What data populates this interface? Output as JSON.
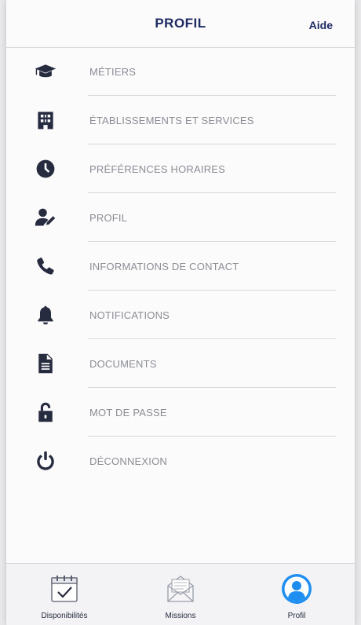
{
  "header": {
    "title": "PROFIL",
    "help_label": "Aide"
  },
  "menu": [
    {
      "label": "MÉTIERS",
      "icon": "graduation-cap-icon"
    },
    {
      "label": "ÉTABLISSEMENTS ET SERVICES",
      "icon": "building-icon"
    },
    {
      "label": "PRÉFÉRENCES HORAIRES",
      "icon": "clock-icon"
    },
    {
      "label": "PROFIL",
      "icon": "user-edit-icon"
    },
    {
      "label": "INFORMATIONS DE CONTACT",
      "icon": "phone-icon"
    },
    {
      "label": "NOTIFICATIONS",
      "icon": "bell-icon"
    },
    {
      "label": "DOCUMENTS",
      "icon": "document-icon"
    },
    {
      "label": "MOT DE PASSE",
      "icon": "unlock-icon"
    },
    {
      "label": "DÉCONNEXION",
      "icon": "power-icon"
    }
  ],
  "tabs": [
    {
      "label": "Disponibilités",
      "icon": "calendar-check-icon"
    },
    {
      "label": "Missions",
      "icon": "envelope-icon"
    },
    {
      "label": "Profil",
      "icon": "user-circle-icon",
      "active": true
    }
  ],
  "colors": {
    "primary": "#1d2a63",
    "accent": "#1f8ef1",
    "icon": "#262b3f",
    "text_muted": "#8b8d94"
  }
}
